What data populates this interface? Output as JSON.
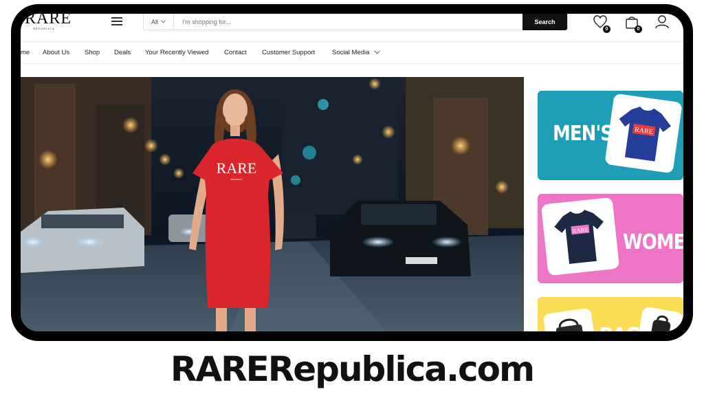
{
  "header": {
    "logo_text": "RARE",
    "logo_sub": "REPUBLICA",
    "search": {
      "category": "All",
      "placeholder": "I'm shopping for...",
      "button_label": "Search"
    },
    "wishlist_count": "0",
    "cart_count": "0"
  },
  "nav": {
    "items": [
      "me",
      "About Us",
      "Shop",
      "Deals",
      "Your Recently Viewed",
      "Contact",
      "Customer Support",
      "Social Media"
    ]
  },
  "hero": {
    "shirt_text": "RARE",
    "shirt_sub": "REPUBLICA"
  },
  "categories": {
    "men_label": "MEN'S",
    "women_label": "WOMEN'",
    "bags_label": "BAGS",
    "tee_text": "RARE"
  },
  "footer": {
    "domain": "RARERepublica.com"
  },
  "colors": {
    "men_tile": "#1d9db6",
    "women_tile": "#ee74c8",
    "bags_tile": "#fbdd55",
    "dress": "#d9252b",
    "search_button": "#111111"
  }
}
